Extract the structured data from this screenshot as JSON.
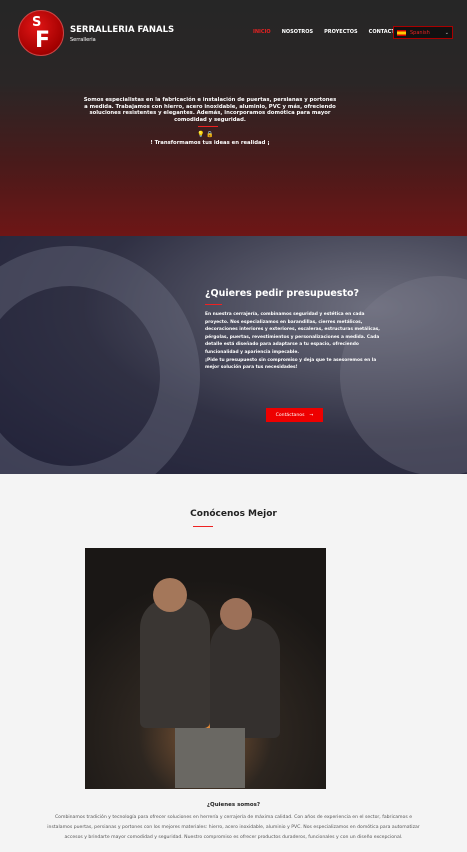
{
  "header": {
    "logo_letters": "SF",
    "brand": "SERRALLERIA FANALS",
    "subtitle": "Serralleria",
    "nav": [
      {
        "label": "INICIO",
        "active": true
      },
      {
        "label": "NOSOTROS"
      },
      {
        "label": "PROYECTOS"
      },
      {
        "label": "CONTACTO"
      }
    ],
    "language": "Spanish"
  },
  "hero": {
    "intro": "Somos especialistas en la fabricación e instalación de puertas, persianas y portones a medida. Trabajamos con hierro, acero inoxidable, aluminio, PVC y más, ofreciendo soluciones resistentes y elegantes. Además, incorporamos domótica para mayor comodidad y seguridad.",
    "icons": "💡 🔒",
    "slogan": "! Transformamos tus ideas en realidad ¡"
  },
  "quote": {
    "title": "¿Quieres pedir presupuesto?",
    "p1": "En nuestra cerrajería, combinamos seguridad y estética en cada proyecto. Nos especializamos en barandillas, cierres metálicos, decoraciones interiores y exteriores, escaleras, estructuras metálicas, pérgolas, puertas, revestimientos y personalizaciones a medida. Cada detalle está diseñado para adaptarse a tu espacio, ofreciendo funcionalidad y apariencia impecable.",
    "p2": "¡Pide tu presupuesto sin compromiso y deja que te asesoremos en la mejor solución para tus necesidades!",
    "button": "Contáctanos",
    "arrow": "→"
  },
  "about": {
    "title": "Conócenos Mejor",
    "subtitle": "¿Quienes somos?",
    "text": "Combinamos tradición y tecnología para ofrecer soluciones en herrería y cerrajería de máxima calidad. Con años de experiencia en el sector, fabricamos e instalamos puertas, persianas y portones con los mejores materiales: hierro, acero inoxidable, aluminio y PVC. Nos especializamos en domótica para automatizar accesos y brindarte mayor comodidad y seguridad. Nuestro compromiso es ofrecer productos duraderos, funcionales y con un diseño excepcional."
  },
  "colors": {
    "accent": "#e00000"
  }
}
